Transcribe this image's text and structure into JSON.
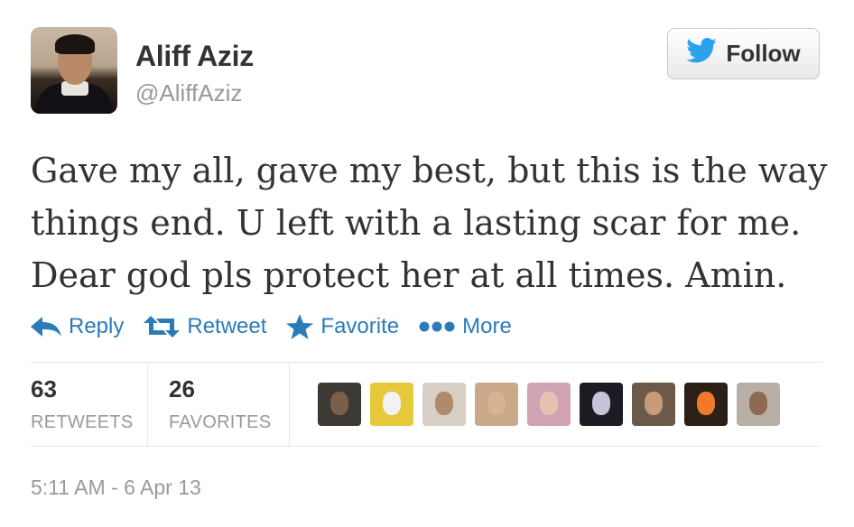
{
  "user": {
    "name": "Aliff Aziz",
    "handle": "@AliffAziz"
  },
  "follow_button": {
    "label": "Follow"
  },
  "tweet": {
    "lines": [
      "Gave my all, gave my best, but this is the way",
      "things end. U left with a lasting scar for me.",
      "Dear god pls protect her at all times. Amin."
    ]
  },
  "actions": {
    "reply": "Reply",
    "retweet": "Retweet",
    "favorite": "Favorite",
    "more": "More"
  },
  "stats": {
    "retweets": {
      "count": "63",
      "label": "RETWEETS"
    },
    "favorites": {
      "count": "26",
      "label": "FAVORITES"
    }
  },
  "favoriter_avatars": [
    {
      "bg": "#3d3a35",
      "face": "#7a5f4a"
    },
    {
      "bg": "#e6c93a",
      "face": "#f2f2f2"
    },
    {
      "bg": "#d8cfc6",
      "face": "#b08a6a"
    },
    {
      "bg": "#c9a98a",
      "face": "#d9b293"
    },
    {
      "bg": "#cfa3b3",
      "face": "#e8c2b0"
    },
    {
      "bg": "#1e1a22",
      "face": "#c8c3d8"
    },
    {
      "bg": "#6b5a4a",
      "face": "#c99a78"
    },
    {
      "bg": "#2a2018",
      "face": "#f07a2a"
    },
    {
      "bg": "#b8b0a6",
      "face": "#8e6a50"
    }
  ],
  "timestamp": "5:11 AM - 6 Apr 13",
  "colors": {
    "accent": "#2b7bb9",
    "twitter_bird": "#2aa3ef",
    "muted": "#999999",
    "text": "#333333"
  },
  "icons": [
    "twitter-bird-icon",
    "reply-icon",
    "retweet-icon",
    "favorite-star-icon",
    "more-dots-icon"
  ]
}
